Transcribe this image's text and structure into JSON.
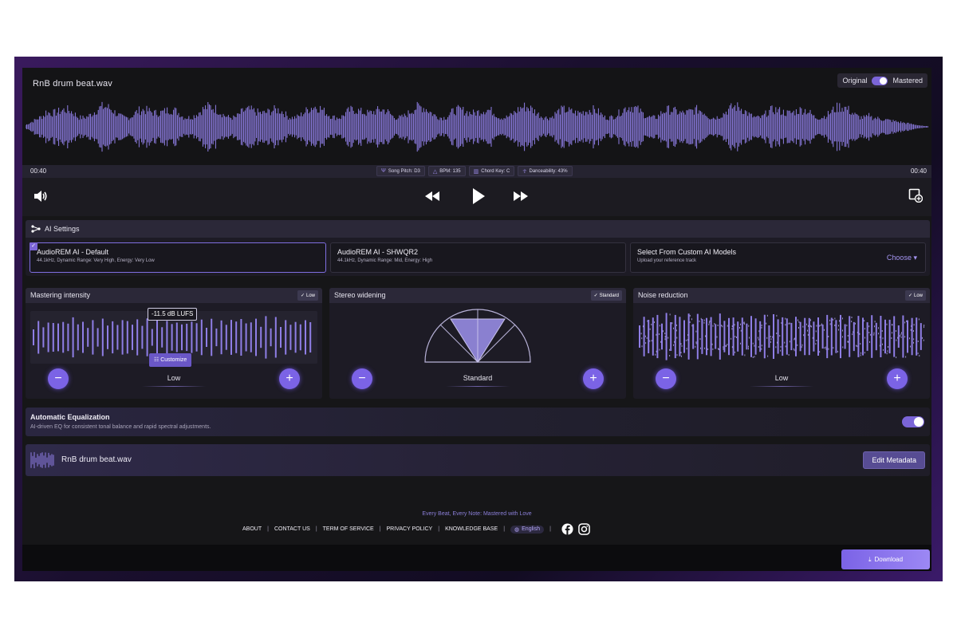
{
  "header": {
    "file_title": "RnB drum beat.wav",
    "toggle_left": "Original",
    "toggle_right": "Mastered",
    "toggle_state": "Mastered"
  },
  "info_bar": {
    "time_start": "00:40",
    "time_end": "00:40",
    "song_pitch": "Song Pitch: D3",
    "bpm": "BPM: 135",
    "chord_key": "Chord Key: C",
    "danceability": "Danceability: 43%"
  },
  "transport": {
    "volume_icon": "volume-icon",
    "rewind_icon": "rewind-icon",
    "play_icon": "play-icon",
    "forward_icon": "fast-forward-icon",
    "export_icon": "export-icon"
  },
  "ai_settings": {
    "title": "AI Settings",
    "cards": [
      {
        "title": "AudioREM AI - Default",
        "subtitle": "44.1kHz, Dynamic Range: Very High, Energy: Very Low",
        "selected": true
      },
      {
        "title": "AudioREM AI - SHWQR2",
        "subtitle": "44.1kHz, Dynamic Range: Mid, Energy: High",
        "selected": false
      },
      {
        "title": "Select From Custom AI Models",
        "subtitle": "Upload your reference track",
        "selected": false
      }
    ],
    "choose_label": "Choose"
  },
  "mastering": {
    "title": "Mastering intensity",
    "badge": "Low",
    "lufs": "-11.5 dB LUFS",
    "customize": "Customize",
    "level": "Low"
  },
  "stereo": {
    "title": "Stereo widening",
    "badge": "Standard",
    "level": "Standard"
  },
  "noise": {
    "title": "Noise reduction",
    "badge": "Low",
    "level": "Low"
  },
  "auto_eq": {
    "title": "Automatic Equalization",
    "description": "AI-driven EQ for consistent tonal balance and rapid spectral adjustments.",
    "enabled": true
  },
  "track": {
    "name": "RnB drum beat.wav",
    "edit_label": "Edit Metadata"
  },
  "footer": {
    "tagline": "Every Beat, Every Note: Mastered with Love",
    "links": [
      "ABOUT",
      "CONTACT US",
      "TERM OF SERVICE",
      "PRIVACY POLICY",
      "KNOWLEDGE BASE"
    ],
    "language": "English",
    "social": [
      "facebook-icon",
      "instagram-icon"
    ]
  },
  "download_label": "Download",
  "colors": {
    "accent": "#7b65d8",
    "wave": "#8f7ee6",
    "background": "#161618"
  }
}
